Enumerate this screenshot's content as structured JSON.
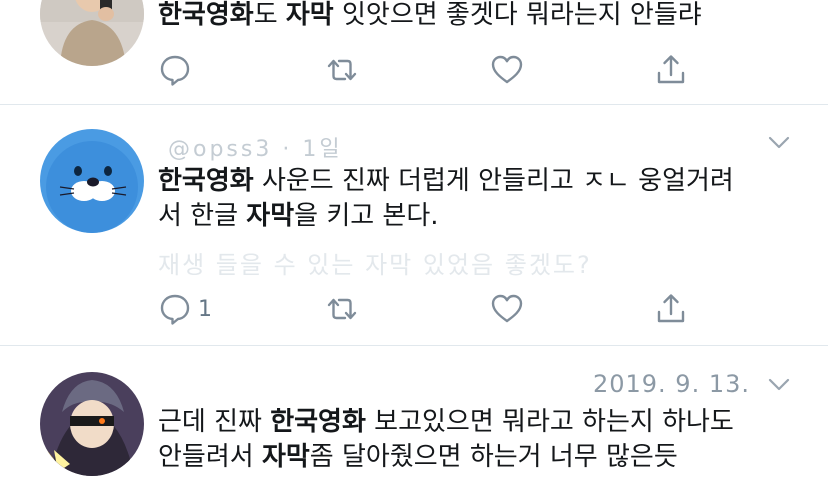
{
  "tweets": [
    {
      "id": "tweet-1",
      "segments": [
        {
          "text": "한국영화",
          "bold": true
        },
        {
          "text": "도 ",
          "bold": false
        },
        {
          "text": "자막",
          "bold": true
        },
        {
          "text": " 잇앗으면 좋겟다 뭐라는지 안들랴",
          "bold": false
        }
      ],
      "reply_count": "",
      "avatar_style": "photo-person"
    },
    {
      "id": "tweet-2",
      "meta_faded": "@opss3 · 1일",
      "segments": [
        {
          "text": "한국영화",
          "bold": true
        },
        {
          "text": " 사운드 진짜 더럽게 안들리고 ㅈㄴ 웅얼거려\n서 한글 ",
          "bold": false
        },
        {
          "text": "자막",
          "bold": true
        },
        {
          "text": "을 키고 본다.",
          "bold": false
        }
      ],
      "faded_line": "재생 들을 수 있는 자막 있었음 좋겠도?",
      "reply_count": "1",
      "avatar_style": "blue-seal"
    },
    {
      "id": "tweet-3",
      "date": "2019. 9. 13.",
      "segments": [
        {
          "text": "근데 진짜 ",
          "bold": false
        },
        {
          "text": "한국영화",
          "bold": true
        },
        {
          "text": " 보고있으면 뭐라고 하는지 하나도\n안들려서 ",
          "bold": false
        },
        {
          "text": "자막",
          "bold": true
        },
        {
          "text": "좀 달아줬으면 하는거 너무 많은듯",
          "bold": false
        }
      ],
      "avatar_style": "anime-character"
    }
  ],
  "colors": {
    "icon": "#7f8c99",
    "divider": "#e1e8ed",
    "text": "#14171a",
    "muted": "#8c99a5"
  },
  "icons": [
    "reply-icon",
    "retweet-icon",
    "like-icon",
    "share-icon",
    "chevron-down-icon"
  ]
}
